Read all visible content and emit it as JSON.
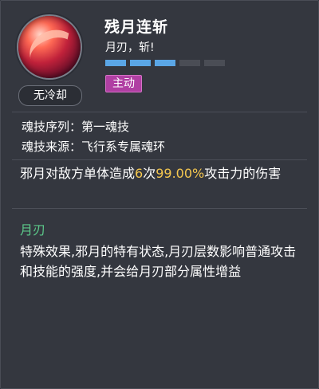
{
  "skill": {
    "name": "残月连斩",
    "subtitle": "月刃，斩!",
    "cooldown": "无冷却",
    "type_badge": "主动",
    "level": {
      "filled": 3,
      "total": 5
    }
  },
  "info": {
    "sequence_label": "魂技序列：",
    "sequence_value": "第一魂技",
    "source_label": "魂技来源：",
    "source_value": "飞行系专属魂环"
  },
  "description": {
    "prefix": "邪月对敌方单体造成",
    "hits": "6",
    "hits_unit": "次",
    "percent": "99.00%",
    "suffix": "攻击力的伤害"
  },
  "effect": {
    "title": "月刃",
    "text": "特殊效果,邪月的特有状态,月刃层数影响普通攻击和技能的强度,并会给月刃部分属性增益"
  },
  "colors": {
    "highlight": "#f5c74f",
    "effect_title": "#5cc98a",
    "level_on": "#5aa6e6",
    "badge": "#b03fa3"
  }
}
